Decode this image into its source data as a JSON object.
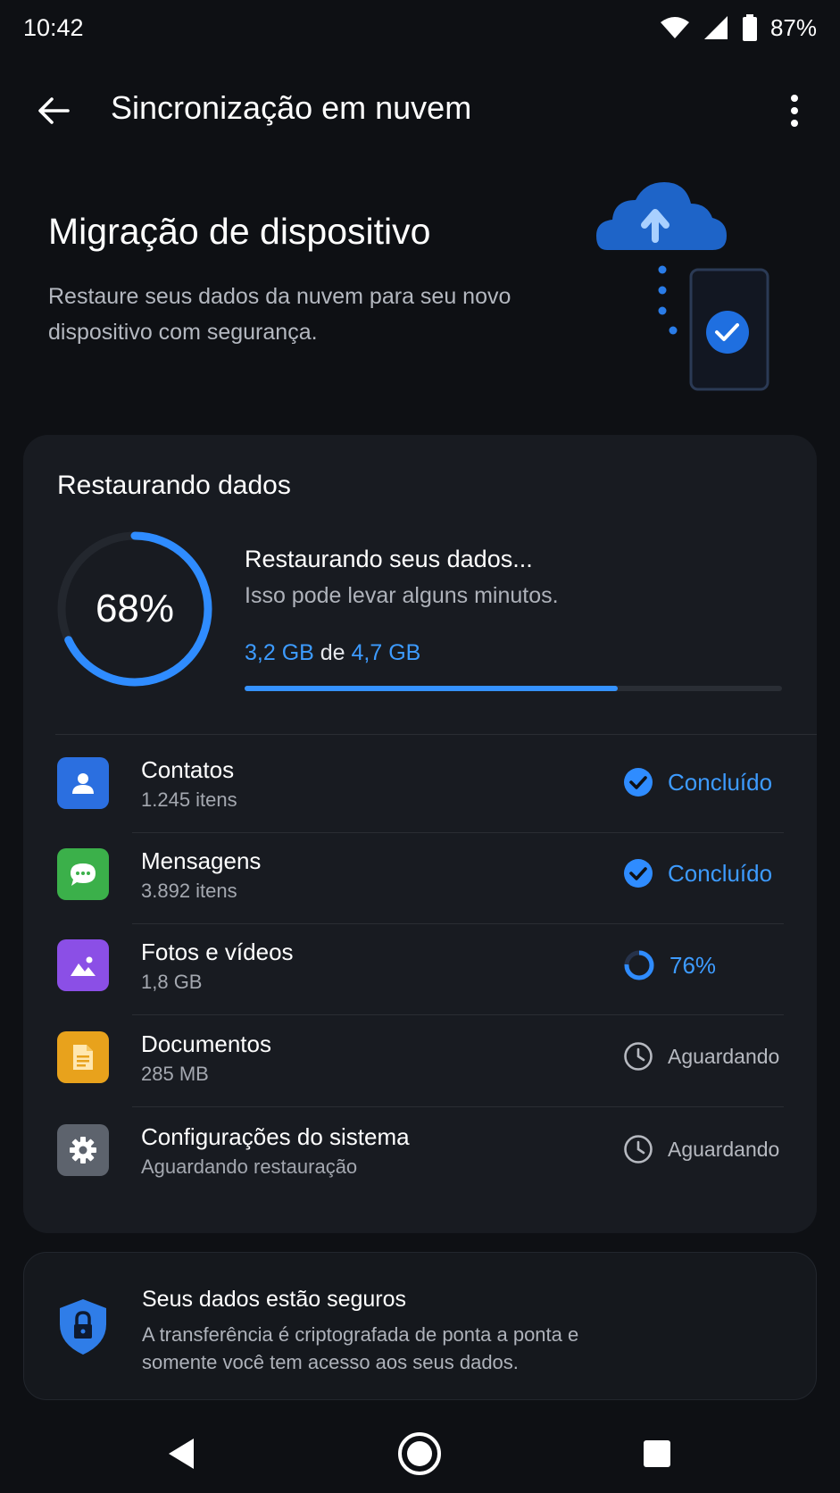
{
  "status_bar": {
    "time": "10:42",
    "battery": "87%",
    "icons": [
      "wifi-icon",
      "signal-icon",
      "battery-icon"
    ]
  },
  "app_bar": {
    "title": "Sincronização em nuvem",
    "icons": [
      "back-arrow-icon",
      "more-vert-icon"
    ]
  },
  "hero": {
    "title": "Migração de dispositivo",
    "description": "Restaure seus dados da nuvem para seu novo dispositivo com segurança."
  },
  "restore": {
    "card_title": "Restaurando dados",
    "percent": 68,
    "percent_label": "68%",
    "status_title": "Restaurando seus dados...",
    "status_sub": "Isso pode levar alguns minutos.",
    "amount_done": "3,2 GB",
    "amount_sep": " de ",
    "amount_total": "4,7 GB",
    "bar_fraction": 0.695
  },
  "items": [
    {
      "name": "Contatos",
      "sub": "1.245 itens",
      "icon": "contact-person-icon",
      "icon_bg": "#2b6fe0",
      "state": "done",
      "status": "Concluído"
    },
    {
      "name": "Mensagens",
      "sub": "3.892 itens",
      "icon": "message-bubble-icon",
      "icon_bg": "#3bb04a",
      "state": "done",
      "status": "Concluído"
    },
    {
      "name": "Fotos e vídeos",
      "sub": "1,8 GB",
      "icon": "image-icon",
      "icon_bg": "#8b4fe6",
      "state": "progress",
      "status": "76%",
      "progress": 0.76
    },
    {
      "name": "Documentos",
      "sub": "285 MB",
      "icon": "document-icon",
      "icon_bg": "#e8a21c",
      "state": "wait",
      "status": "Aguardando"
    },
    {
      "name": "Configurações do sistema",
      "sub": "Aguardando restauração",
      "icon": "gear-icon",
      "icon_bg": "#5d636d",
      "state": "wait",
      "status": "Aguardando"
    }
  ],
  "secure": {
    "title": "Seus dados estão seguros",
    "description": "A transferência é criptografada de ponta a ponta e somente você tem acesso aos seus dados.",
    "icon": "shield-lock-icon"
  },
  "nav": {
    "icons": [
      "nav-back-icon",
      "nav-home-icon",
      "nav-recents-icon"
    ]
  },
  "colors": {
    "accent": "#3592ff",
    "background": "#0e1014",
    "card": "#181b21"
  }
}
